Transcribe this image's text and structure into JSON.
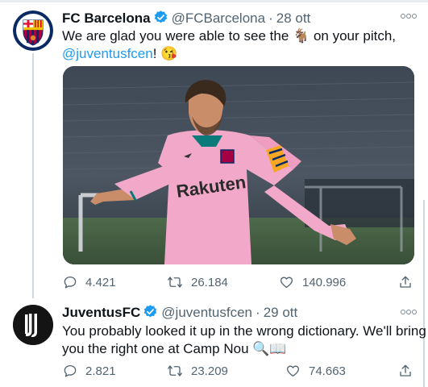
{
  "tweets": [
    {
      "name": "FC Barcelona",
      "handle": "@FCBarcelona",
      "date": "28 ott",
      "text_line1_a": "We are glad you were able to see the",
      "goat_emoji": "🐐",
      "text_line1_b": "on your pitch,",
      "mention": "@juventusfcen",
      "text_line2_tail": "!",
      "kiss_emoji": "😘",
      "image_jersey_text": "Rakuten",
      "replies": "4.421",
      "retweets": "26.184",
      "likes": "140.996"
    },
    {
      "name": "JuventusFC",
      "handle": "@juventusfcen",
      "date": "29 ott",
      "text_line1": "You probably looked it up in the wrong dictionary. We'll bring",
      "text_line2": "you the right one at Camp Nou",
      "emojis": "🔍📖",
      "replies": "2.821",
      "retweets": "23.209",
      "likes": "74.663"
    }
  ],
  "colors": {
    "verified": "#1d9bf0",
    "mention": "#1d9bf0",
    "secondary_text": "#536471",
    "jersey_pink": "#f2a9c9"
  },
  "icons": [
    "reply-icon",
    "retweet-icon",
    "like-icon",
    "share-icon",
    "verified-badge-icon",
    "more-icon"
  ]
}
